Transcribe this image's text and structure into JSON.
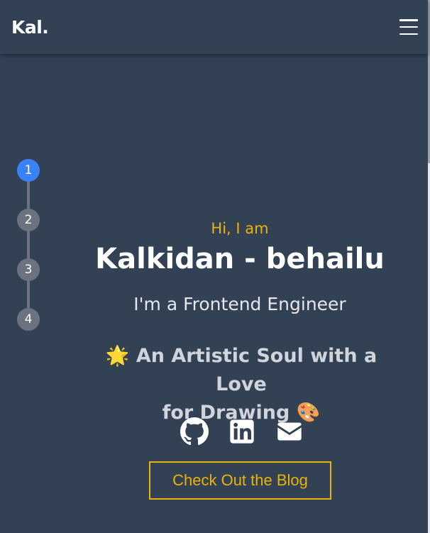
{
  "navbar": {
    "brand": "Kal.",
    "menu_icon": "hamburger-menu-icon"
  },
  "stepper": {
    "steps": [
      "1",
      "2",
      "3",
      "4"
    ],
    "active_step": 1,
    "active_color": "#3b82f6"
  },
  "hero": {
    "greeting": "Hi, I am",
    "name": "Kalkidan - behailu",
    "role": "I'm a Frontend Engineer",
    "tagline_line1": "🌟 An Artistic Soul with a Love",
    "tagline_line2": "for Drawing 🎨"
  },
  "socials": [
    {
      "icon": "github-icon"
    },
    {
      "icon": "linkedin-icon"
    },
    {
      "icon": "email-icon"
    }
  ],
  "cta": {
    "label": "Check Out the Blog"
  },
  "colors": {
    "background": "#334155",
    "accent": "#eab308",
    "step_inactive": "#6b7280"
  }
}
